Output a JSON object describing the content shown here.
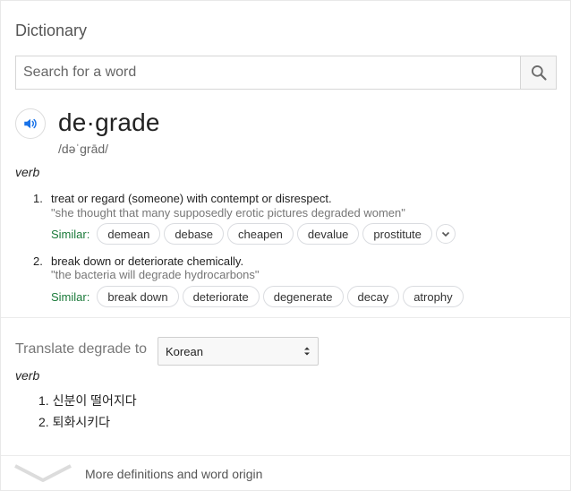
{
  "header": {
    "title": "Dictionary"
  },
  "search": {
    "placeholder": "Search for a word",
    "value": ""
  },
  "entry": {
    "word": "de·grade",
    "phonetic": "/dəˈɡrād/",
    "part_of_speech": "verb",
    "similar_label": "Similar:",
    "senses": [
      {
        "number": "1.",
        "definition": "treat or regard (someone) with contempt or disrespect.",
        "example": "\"she thought that many supposedly erotic pictures degraded women\"",
        "similar": [
          "demean",
          "debase",
          "cheapen",
          "devalue",
          "prostitute"
        ]
      },
      {
        "number": "2.",
        "definition": "break down or deteriorate chemically.",
        "example": "\"the bacteria will degrade hydrocarbons\"",
        "similar": [
          "break down",
          "deteriorate",
          "degenerate",
          "decay",
          "atrophy"
        ]
      }
    ]
  },
  "translate": {
    "label": "Translate degrade to",
    "language": "Korean",
    "part_of_speech": "verb",
    "items": [
      {
        "number": "1.",
        "text": "신분이 떨어지다"
      },
      {
        "number": "2.",
        "text": "퇴화시키다"
      }
    ]
  },
  "footer": {
    "more_label": "More definitions and word origin"
  },
  "colors": {
    "accent": "#1a73e8",
    "similar_label": "#1b7a3a",
    "example_text": "#767676"
  },
  "icons": {
    "search": "search-icon",
    "speaker": "speaker-icon",
    "expand": "chevron-down-icon"
  }
}
